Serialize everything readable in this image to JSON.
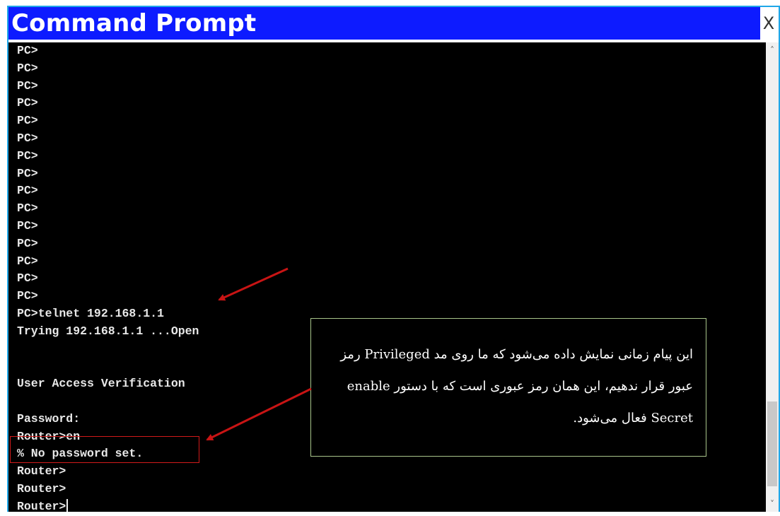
{
  "window": {
    "title": "Command Prompt",
    "close_label": "X",
    "border_color": "#1fa7e8",
    "title_color": "#0d1bff"
  },
  "console": {
    "lines": [
      "PC>",
      "PC>",
      "PC>",
      "PC>",
      "PC>",
      "PC>",
      "PC>",
      "PC>",
      "PC>",
      "PC>",
      "PC>",
      "PC>",
      "PC>",
      "PC>",
      "PC>",
      "PC>telnet 192.168.1.1",
      "Trying 192.168.1.1 ...Open",
      "",
      "",
      "User Access Verification",
      "",
      "Password:",
      "Router>en",
      "% No password set.",
      "Router>",
      "Router>",
      "Router>"
    ]
  },
  "annotation": {
    "text": "این پیام زمانی نمایش داده می‌شود که ما روی مد Privileged رمز عبور قرار ندهیم، این همان رمز عبوری است که با دستور enable Secret فعال می‌شود.",
    "arrow_color": "#c81414",
    "highlight_color": "#d11a1a"
  },
  "scrollbar": {
    "up_icon": "chevron-up-icon",
    "down_icon": "chevron-down-icon"
  }
}
